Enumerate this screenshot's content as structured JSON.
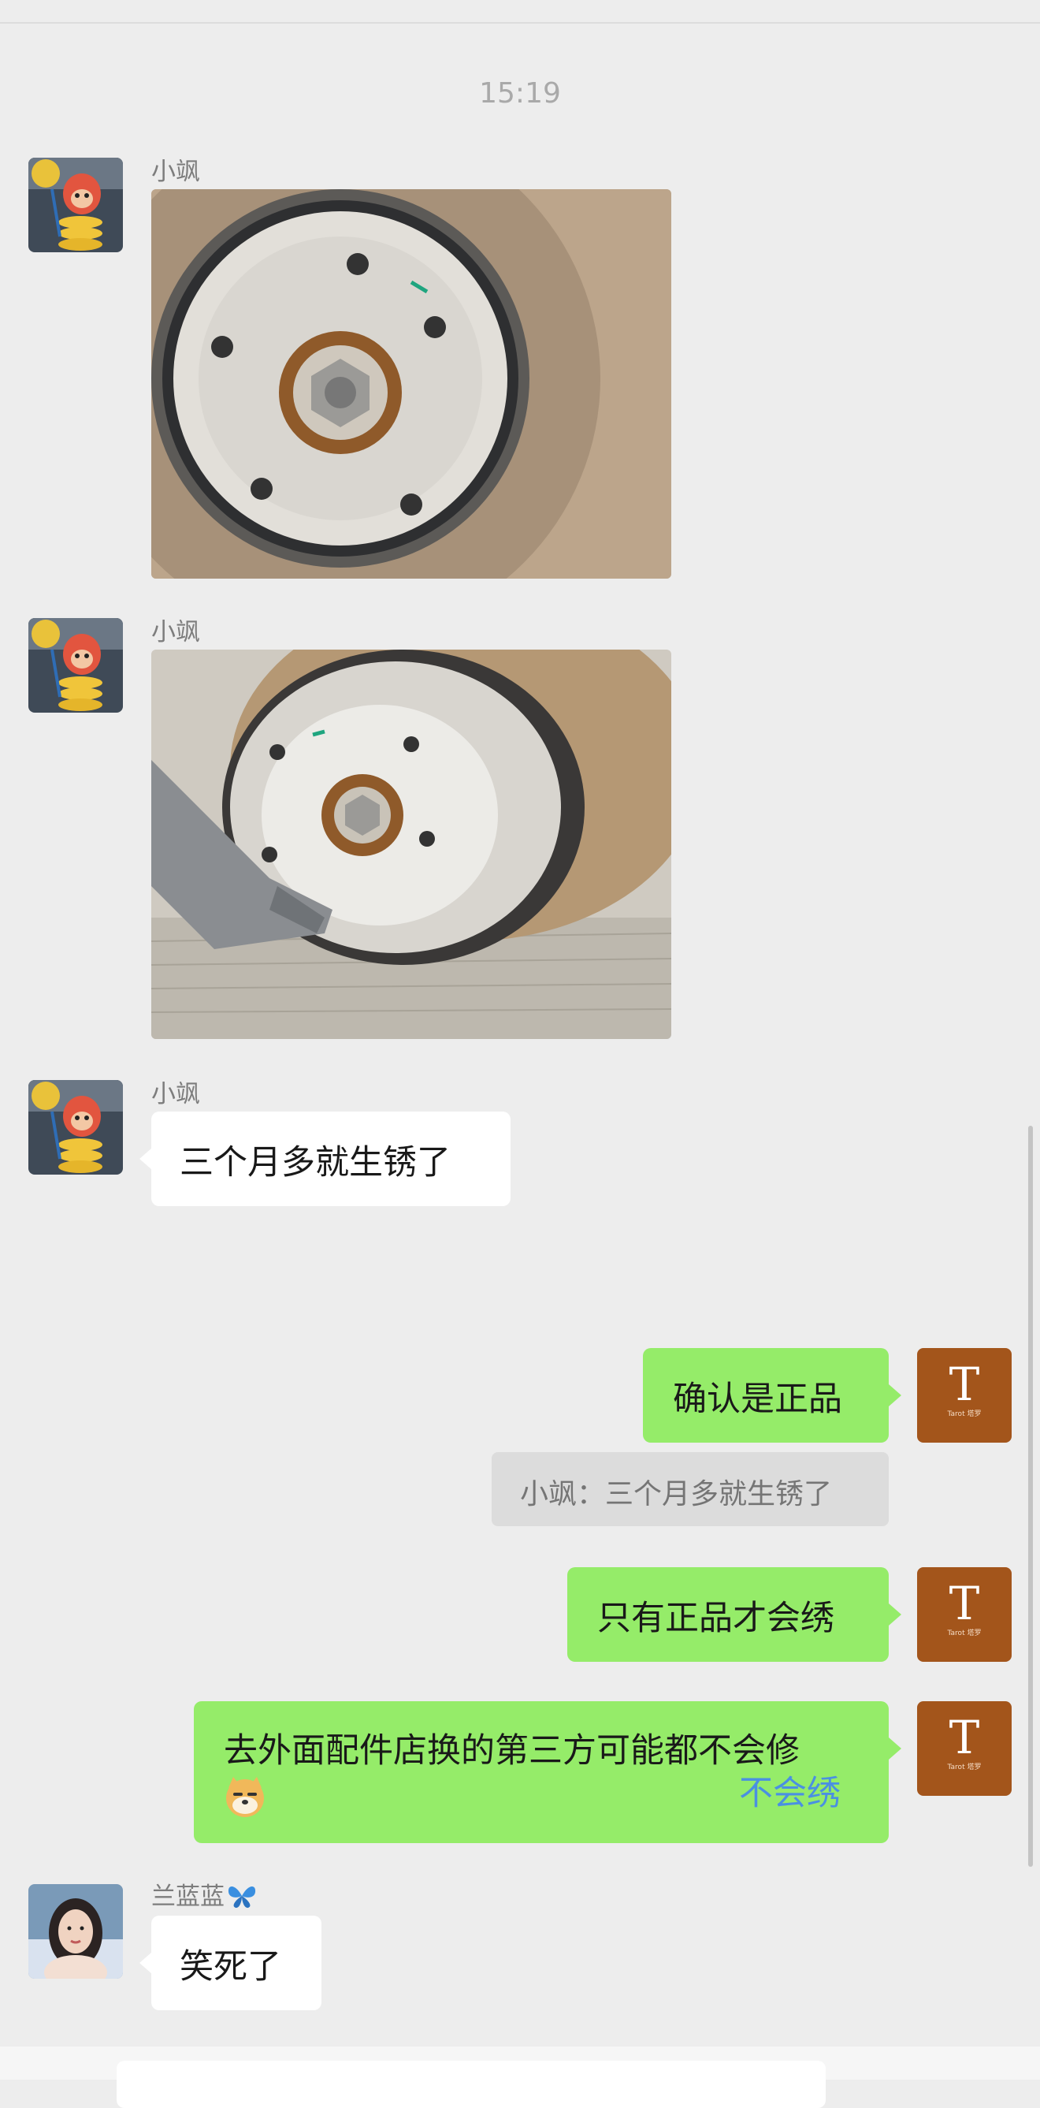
{
  "chat": {
    "timestamp": "15:19",
    "messages": [
      {
        "sender": "小飒",
        "type": "image",
        "description_icon": "brake-disc-photo"
      },
      {
        "sender": "小飒",
        "type": "image",
        "description_icon": "brake-disc-photo"
      },
      {
        "sender": "小飒",
        "type": "text",
        "text": "三个月多就生锈了"
      },
      {
        "from": "me",
        "type": "text",
        "text": "确认是正品"
      },
      {
        "from": "me",
        "type": "quote",
        "text": "小飒：三个月多就生锈了"
      },
      {
        "from": "me",
        "type": "text",
        "text": "只有正品才会绣"
      },
      {
        "from": "me",
        "type": "text",
        "line1": "去外面配件店换的第三方可能都不会修",
        "link": "不会绣",
        "emoji": "doge-emoji"
      },
      {
        "sender": "兰蓝蓝",
        "type": "text",
        "text": "笑死了"
      }
    ]
  },
  "my_avatar": {
    "letter": "T",
    "sub": "Tarot 塔罗"
  },
  "colors": {
    "background": "#ededed",
    "bubble_green": "#95ec69",
    "bubble_white": "#ffffff",
    "avatar_brown": "#a3551b",
    "link_blue": "#4a90e2"
  }
}
